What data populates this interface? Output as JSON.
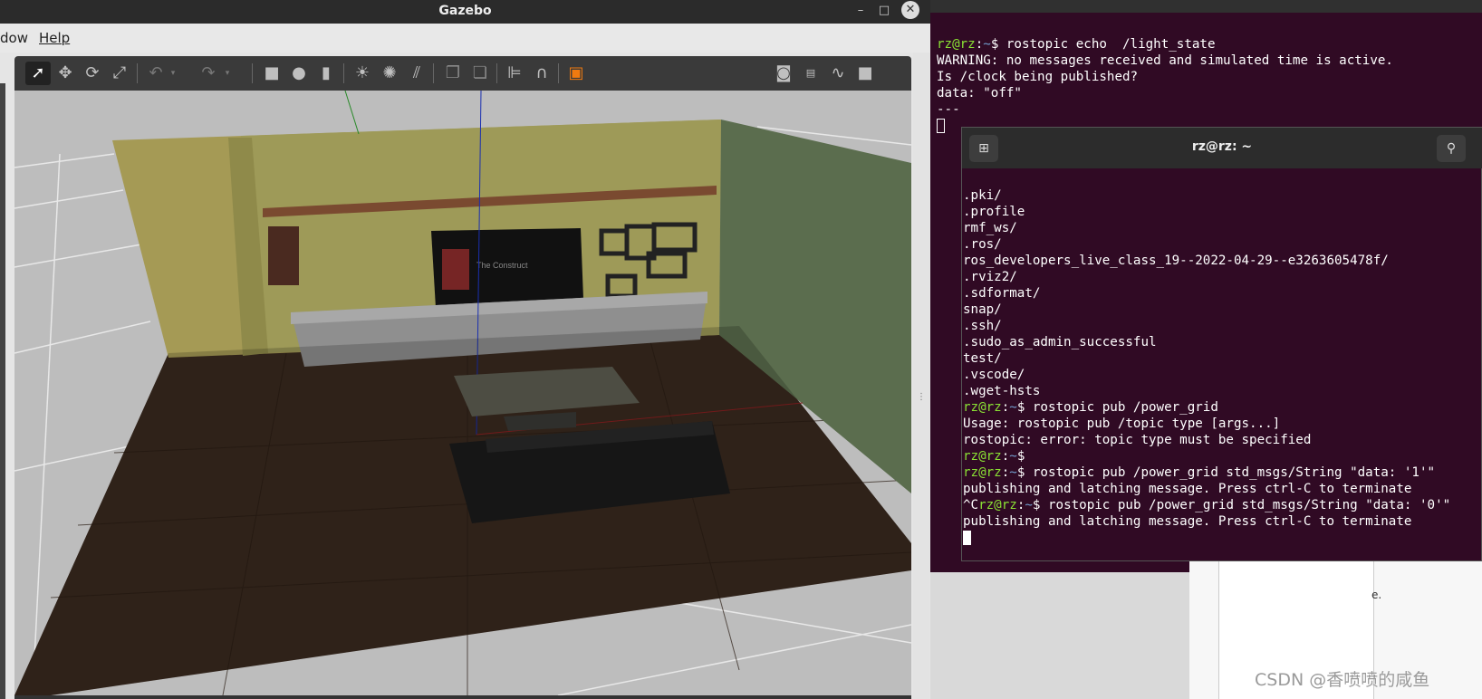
{
  "gazebo": {
    "title": "Gazebo",
    "minimize": "–",
    "maximize": "□",
    "close": "✕",
    "menu": [
      "dow",
      "Help"
    ],
    "toolbar_icons": [
      "select-arrow-icon",
      "translate-icon",
      "rotate-icon",
      "scale-icon",
      "undo-icon",
      "undo-dropdown-icon",
      "redo-icon",
      "redo-dropdown-icon",
      "box-icon",
      "sphere-icon",
      "cylinder-icon",
      "point-light-icon",
      "spot-light-icon",
      "directional-light-icon",
      "copy-icon",
      "paste-icon",
      "align-icon",
      "snap-magnet-icon",
      "view-angle-icon",
      "screenshot-icon",
      "log-icon",
      "plot-icon",
      "record-video-icon"
    ],
    "scene": {
      "tv_text": "The Construct"
    }
  },
  "terminal_back": {
    "lines": [
      {
        "user": "rz@rz",
        "path": "~",
        "cmd": "$ rostopic echo  /light_state"
      },
      {
        "text": "WARNING: no messages received and simulated time is active."
      },
      {
        "text": "Is /clock being published?"
      },
      {
        "text": "data: \"off\""
      },
      {
        "text": "---"
      }
    ]
  },
  "terminal_front": {
    "title": "rz@rz: ~",
    "lines": [
      {
        "text": ".pki/"
      },
      {
        "text": ".profile"
      },
      {
        "text": "rmf_ws/"
      },
      {
        "text": ".ros/"
      },
      {
        "text": "ros_developers_live_class_19--2022-04-29--e3263605478f/"
      },
      {
        "text": ".rviz2/"
      },
      {
        "text": ".sdformat/"
      },
      {
        "text": "snap/"
      },
      {
        "text": ".ssh/"
      },
      {
        "text": ".sudo_as_admin_successful"
      },
      {
        "text": "test/"
      },
      {
        "text": ".vscode/"
      },
      {
        "text": ".wget-hsts"
      },
      {
        "user": "rz@rz",
        "path": "~",
        "cmd": "$ rostopic pub /power_grid"
      },
      {
        "text": ""
      },
      {
        "text": "Usage: rostopic pub /topic type [args...]"
      },
      {
        "text": ""
      },
      {
        "text": "rostopic: error: topic type must be specified"
      },
      {
        "user": "rz@rz",
        "path": "~",
        "cmd": "$"
      },
      {
        "user": "rz@rz",
        "path": "~",
        "cmd": "$ rostopic pub /power_grid std_msgs/String \"data: '1'\""
      },
      {
        "text": "publishing and latching message. Press ctrl-C to terminate"
      },
      {
        "prefix": "^C",
        "user": "rz@rz",
        "path": "~",
        "cmd": "$ rostopic pub /power_grid std_msgs/String \"data: '0'\""
      },
      {
        "text": "publishing and latching message. Press ctrl-C to terminate"
      }
    ]
  },
  "background_doc": {
    "fragment": "e."
  },
  "watermark": "CSDN @香喷喷的咸鱼"
}
